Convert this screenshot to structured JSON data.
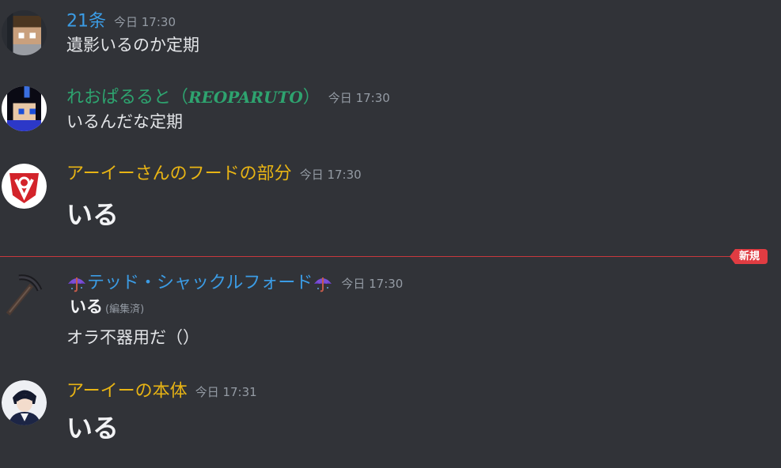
{
  "messages": [
    {
      "username": "21条",
      "timestamp": "今日 17:30",
      "text": "遺影いるのか定期",
      "username_color": "#3b9ce5",
      "avatar_icon": "pixel-character-avatar"
    },
    {
      "username": "れおぱるると（",
      "username_latin": "REOPARUTO",
      "username_close": "）",
      "timestamp": "今日 17:30",
      "text": "いるんだな定期",
      "username_color": "#2ea36f",
      "avatar_icon": "pixel-dark-hair-avatar"
    },
    {
      "username": "アーイーさんのフードの部分",
      "timestamp": "今日 17:30",
      "text": "いる",
      "username_color": "#e8b414",
      "avatar_icon": "red-shield-avatar"
    },
    {
      "username": "テッド・シャックルフォード",
      "timestamp": "今日 17:30",
      "text_bold": "いる",
      "edited_label": "(編集済)",
      "text": "オラ不器用だ（）",
      "username_color": "#3b9ce5",
      "avatar_icon": "pickaxe-avatar",
      "decoration_icon": "umbrella-icon"
    },
    {
      "username": "アーイーの本体",
      "timestamp": "今日 17:31",
      "text": "いる",
      "username_color": "#e8b414",
      "avatar_icon": "anime-character-avatar"
    }
  ],
  "divider": {
    "new_label": "新規",
    "color": "#c8383d"
  },
  "colors": {
    "background": "#313338",
    "timestamp": "#949ba4",
    "text": "#e3e5e8"
  }
}
